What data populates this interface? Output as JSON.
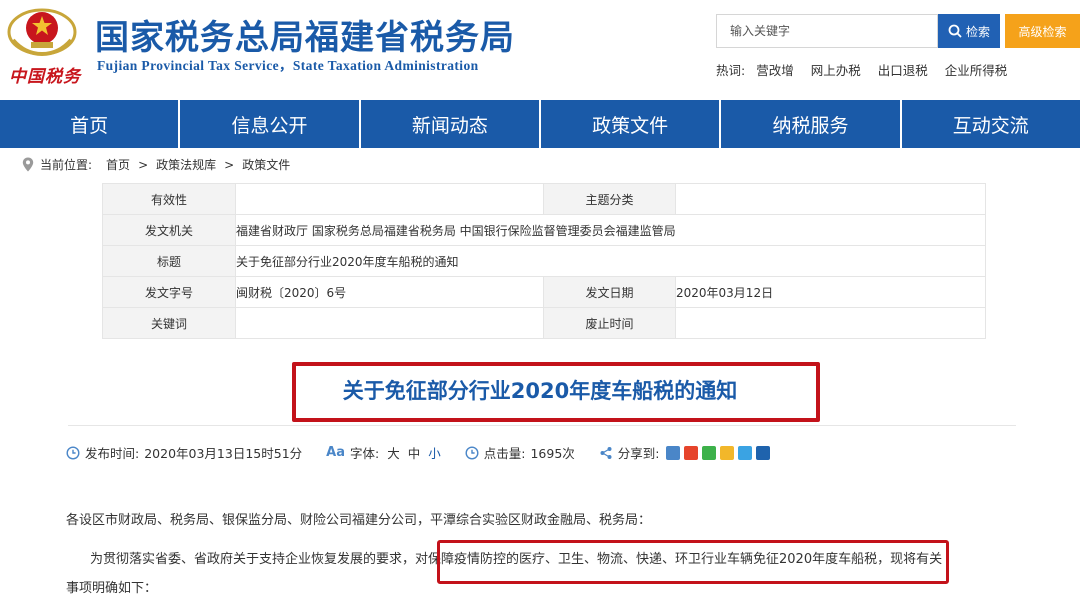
{
  "header": {
    "brand_script": "中国税务",
    "title": "国家税务总局福建省税务局",
    "subtitle": "Fujian Provincial Tax Service，State Taxation Administration",
    "search_placeholder": "输入关键字",
    "search_button": "检索",
    "advanced_button": "高级检索",
    "hotwords_label": "热词:",
    "hotwords": [
      "营改增",
      "网上办税",
      "出口退税",
      "企业所得税"
    ]
  },
  "nav": [
    "首页",
    "信息公开",
    "新闻动态",
    "政策文件",
    "纳税服务",
    "互动交流"
  ],
  "breadcrumb": {
    "label": "当前位置:",
    "items": [
      "首页",
      "政策法规库",
      "政策文件"
    ],
    "separator": ">"
  },
  "meta": {
    "validity_label": "有效性",
    "validity": "",
    "category_label": "主题分类",
    "category": "",
    "issuer_label": "发文机关",
    "issuer": "福建省财政厅 国家税务总局福建省税务局 中国银行保险监督管理委员会福建监管局",
    "title_label": "标题",
    "title": "关于免征部分行业2020年度车船税的通知",
    "doc_no_label": "发文字号",
    "doc_no": "闽财税〔2020〕6号",
    "issue_date_label": "发文日期",
    "issue_date": "2020年03月12日",
    "keywords_label": "关键词",
    "keywords": "",
    "expiry_label": "废止时间",
    "expiry": ""
  },
  "article": {
    "title": "关于免征部分行业2020年度车船税的通知",
    "publish_label": "发布时间:",
    "publish_time": "2020年03月13日15时51分",
    "font_label": "字体:",
    "font_large": "大",
    "font_medium": "中",
    "font_small": "小",
    "views_label": "点击量:",
    "views": "1695次",
    "share_label": "分享到:",
    "para1": "各设区市财政局、税务局、银保监分局、财险公司福建分公司，平潭综合实验区财政金融局、税务局：",
    "para2_before": "为贯彻落实省委、省政府关于支持企业恢复发展的要求，",
    "para2_highlight": "对保障疫情防控的医疗、卫生、物流、快递、环卫行业车辆免征2020年度车船税",
    "para2_after": "，现将有关",
    "para3": "事项明确如下："
  },
  "colors": {
    "brand_blue": "#1a5aa8",
    "search_blue": "#2161b4",
    "advanced_orange": "#f5a21a",
    "highlight_red": "#c3121a",
    "logo_red": "#c8161d"
  }
}
